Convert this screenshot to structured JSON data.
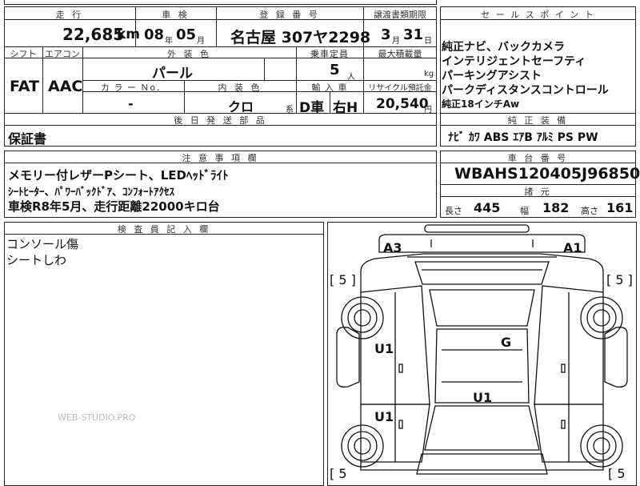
{
  "top_cut": {
    "text": "「日のの」"
  },
  "main_table": {
    "headers": {
      "mileage": "走 行",
      "inspection": "車 検",
      "registration": "登 録 番 号",
      "transfer_deadline": "譲渡書類期限",
      "shift": "シフト",
      "aircon": "エアコン",
      "exterior_color": "外 装 色",
      "capacity": "乗車定員",
      "max_load": "最大積載量",
      "color_no": "カ ラ ー Ｎo．",
      "interior_color": "内 装 色",
      "import": "輸 入 車",
      "recycle_fee": "リサイクル預託金",
      "later_parts": "後 日 発 送 部 品"
    },
    "mileage_value": "22,685",
    "mileage_unit": "km",
    "inspection_year": "08",
    "inspection_year_unit": "年",
    "inspection_month": "05",
    "inspection_month_unit": "月",
    "registration_value": "名古屋 307ヤ2298",
    "transfer_day": "3",
    "transfer_month_unit": "月",
    "transfer_date": "31",
    "transfer_day_unit": "日",
    "shift_value": "FAT",
    "aircon_value": "AAC",
    "exterior_color_value": "パール",
    "capacity_value": "5",
    "capacity_unit": "人",
    "max_load_unit": "kg",
    "color_no_value": "-",
    "interior_color_value": "クロ",
    "interior_color_unit": "系",
    "import_value": "D車",
    "steering_value": "右H",
    "recycle_value": "20,540",
    "recycle_unit": "円",
    "later_parts_value": "保証書"
  },
  "selling_points": {
    "header": "セ ー ル ス ポ イ ン ト",
    "lines": [
      "純正ナビ、バックカメラ",
      "インテリジェントセーフティ",
      "パーキングアシスト",
      "パークディスタンスコントロール",
      "純正18インチAw"
    ]
  },
  "equipment": {
    "header": "純 正 装 備",
    "value": "ﾅﾋﾞ ｶﾜ ABS ｴｱB ｱﾙﾐ PS PW"
  },
  "chassis": {
    "header": "車 台 番 号",
    "value": "WBAHS120405J96850"
  },
  "dimensions": {
    "header": "諸 元",
    "length_label": "長さ",
    "length_value": "445",
    "width_label": "幅",
    "width_value": "182",
    "height_label": "高さ",
    "height_value": "161"
  },
  "notes": {
    "header": "注 意 事 項 欄",
    "lines": [
      "メモリー付レザーPシート、LEDﾍｯﾄﾞﾗｲﾄ",
      "ｼｰﾄﾋｰﾀｰ、ﾊﾟﾜｰﾊﾞｯｸﾄﾞｱ、ｺﾝﾌｫｰﾄｱｸｾｽ",
      "車検R8年5月、走行距離22000キロ台"
    ]
  },
  "inspector": {
    "header": "検 査 員 記 入 欄",
    "lines": [
      "コンソール傷",
      "シートしわ"
    ]
  },
  "diagram": {
    "marks": {
      "a3": "A3",
      "a1": "A1",
      "tire_fl": "[ 5 ]",
      "tire_fr": "[ 5 ]",
      "tire_rl": "[ 5",
      "tire_rr": "[ 5",
      "u1_left_upper": "U1",
      "u1_left_lower": "U1",
      "u1_roof": "U1",
      "g_windshield": "G"
    }
  },
  "watermark": "WEB-STUDIO.PRO"
}
